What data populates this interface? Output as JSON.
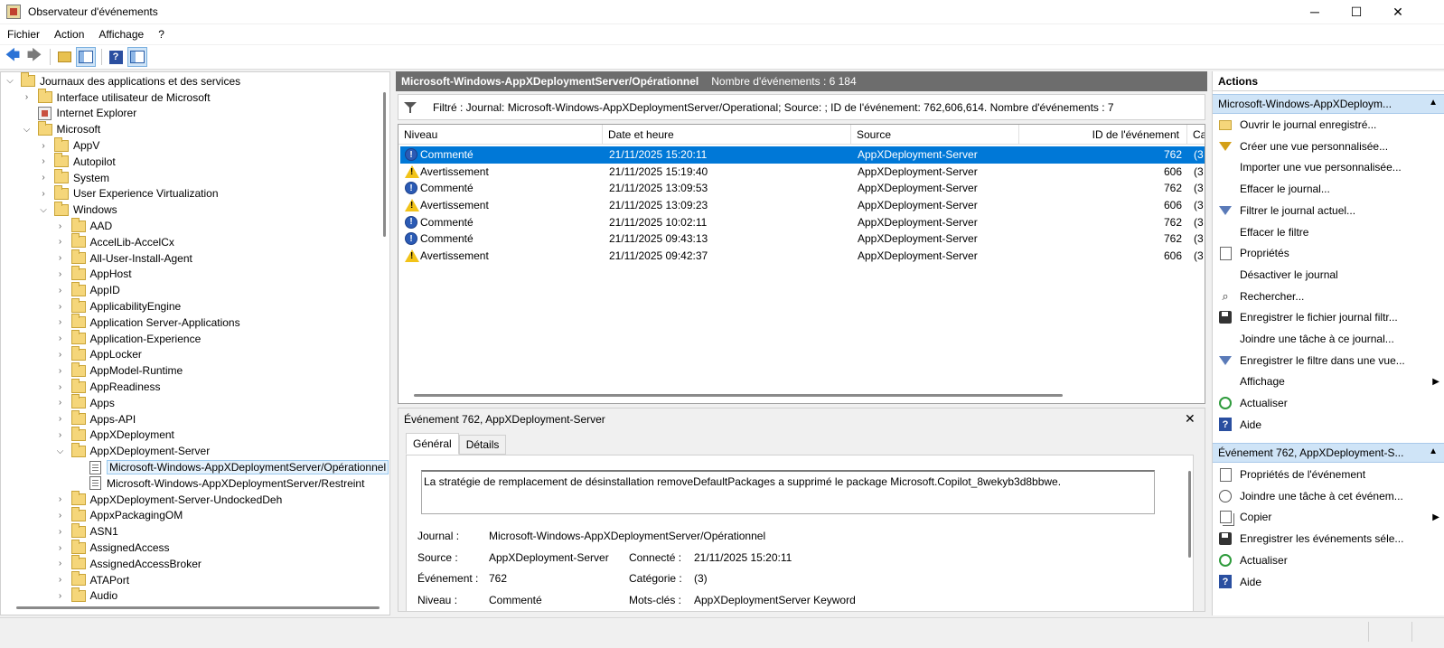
{
  "window": {
    "title": "Observateur d'événements",
    "minimize": "─",
    "maximize": "☐",
    "close": "✕"
  },
  "menu": [
    "Fichier",
    "Action",
    "Affichage",
    "?"
  ],
  "toolbar": {
    "back": "🡄",
    "forward": "🡆",
    "help": "?"
  },
  "tree": [
    {
      "label": "Journaux des applications et des services",
      "level": 0,
      "expander": "open",
      "icon": "folder"
    },
    {
      "label": "Interface utilisateur de Microsoft",
      "level": 1,
      "expander": "closed",
      "icon": "folder"
    },
    {
      "label": "Internet Explorer",
      "level": 1,
      "expander": "none",
      "icon": "ie"
    },
    {
      "label": "Microsoft",
      "level": 1,
      "expander": "open",
      "icon": "folder"
    },
    {
      "label": "AppV",
      "level": 2,
      "expander": "closed",
      "icon": "folder"
    },
    {
      "label": "Autopilot",
      "level": 2,
      "expander": "closed",
      "icon": "folder"
    },
    {
      "label": "System",
      "level": 2,
      "expander": "closed",
      "icon": "folder"
    },
    {
      "label": "User Experience Virtualization",
      "level": 2,
      "expander": "closed",
      "icon": "folder"
    },
    {
      "label": "Windows",
      "level": 2,
      "expander": "open",
      "icon": "folder"
    },
    {
      "label": "AAD",
      "level": 3,
      "expander": "closed",
      "icon": "folder"
    },
    {
      "label": "AccelLib-AccelCx",
      "level": 3,
      "expander": "closed",
      "icon": "folder"
    },
    {
      "label": "All-User-Install-Agent",
      "level": 3,
      "expander": "closed",
      "icon": "folder"
    },
    {
      "label": "AppHost",
      "level": 3,
      "expander": "closed",
      "icon": "folder"
    },
    {
      "label": "AppID",
      "level": 3,
      "expander": "closed",
      "icon": "folder"
    },
    {
      "label": "ApplicabilityEngine",
      "level": 3,
      "expander": "closed",
      "icon": "folder"
    },
    {
      "label": "Application Server-Applications",
      "level": 3,
      "expander": "closed",
      "icon": "folder"
    },
    {
      "label": "Application-Experience",
      "level": 3,
      "expander": "closed",
      "icon": "folder"
    },
    {
      "label": "AppLocker",
      "level": 3,
      "expander": "closed",
      "icon": "folder"
    },
    {
      "label": "AppModel-Runtime",
      "level": 3,
      "expander": "closed",
      "icon": "folder"
    },
    {
      "label": "AppReadiness",
      "level": 3,
      "expander": "closed",
      "icon": "folder"
    },
    {
      "label": "Apps",
      "level": 3,
      "expander": "closed",
      "icon": "folder"
    },
    {
      "label": "Apps-API",
      "level": 3,
      "expander": "closed",
      "icon": "folder"
    },
    {
      "label": "AppXDeployment",
      "level": 3,
      "expander": "closed",
      "icon": "folder"
    },
    {
      "label": "AppXDeployment-Server",
      "level": 3,
      "expander": "open",
      "icon": "folder"
    },
    {
      "label": "Microsoft-Windows-AppXDeploymentServer/Opérationnel",
      "level": 4,
      "expander": "none",
      "icon": "log",
      "selected": true
    },
    {
      "label": "Microsoft-Windows-AppXDeploymentServer/Restreint",
      "level": 4,
      "expander": "none",
      "icon": "log"
    },
    {
      "label": "AppXDeployment-Server-UndockedDeh",
      "level": 3,
      "expander": "closed",
      "icon": "folder"
    },
    {
      "label": "AppxPackagingOM",
      "level": 3,
      "expander": "closed",
      "icon": "folder"
    },
    {
      "label": "ASN1",
      "level": 3,
      "expander": "closed",
      "icon": "folder"
    },
    {
      "label": "AssignedAccess",
      "level": 3,
      "expander": "closed",
      "icon": "folder"
    },
    {
      "label": "AssignedAccessBroker",
      "level": 3,
      "expander": "closed",
      "icon": "folder"
    },
    {
      "label": "ATAPort",
      "level": 3,
      "expander": "closed",
      "icon": "folder"
    },
    {
      "label": "Audio",
      "level": 3,
      "expander": "closed",
      "icon": "folder"
    }
  ],
  "center": {
    "log_name": "Microsoft-Windows-AppXDeploymentServer/Opérationnel",
    "event_count": "Nombre d'événements : 6 184",
    "filter_text": "Filtré : Journal: Microsoft-Windows-AppXDeploymentServer/Operational; Source: ; ID de l'événement: 762,606,614. Nombre d'événements : 7",
    "columns": {
      "level": "Niveau",
      "date": "Date et heure",
      "source": "Source",
      "id": "ID de l'événement",
      "category": "Ca"
    },
    "rows": [
      {
        "level": "Commenté",
        "type": "info",
        "date": "21/11/2025 15:20:11",
        "source": "AppXDeployment-Server",
        "id": "762",
        "category": "(3",
        "selected": true
      },
      {
        "level": "Avertissement",
        "type": "warn",
        "date": "21/11/2025 15:19:40",
        "source": "AppXDeployment-Server",
        "id": "606",
        "category": "(3"
      },
      {
        "level": "Commenté",
        "type": "info",
        "date": "21/11/2025 13:09:53",
        "source": "AppXDeployment-Server",
        "id": "762",
        "category": "(3"
      },
      {
        "level": "Avertissement",
        "type": "warn",
        "date": "21/11/2025 13:09:23",
        "source": "AppXDeployment-Server",
        "id": "606",
        "category": "(3"
      },
      {
        "level": "Commenté",
        "type": "info",
        "date": "21/11/2025 10:02:11",
        "source": "AppXDeployment-Server",
        "id": "762",
        "category": "(3"
      },
      {
        "level": "Commenté",
        "type": "info",
        "date": "21/11/2025 09:43:13",
        "source": "AppXDeployment-Server",
        "id": "762",
        "category": "(3"
      },
      {
        "level": "Avertissement",
        "type": "warn",
        "date": "21/11/2025 09:42:37",
        "source": "AppXDeployment-Server",
        "id": "606",
        "category": "(3"
      }
    ]
  },
  "detail": {
    "title": "Événement 762, AppXDeployment-Server",
    "close": "✕",
    "tabs": [
      "Général",
      "Détails"
    ],
    "description": "La stratégie de remplacement de désinstallation removeDefaultPackages a supprimé le package Microsoft.Copilot_8wekyb3d8bbwe.",
    "journal_label": "Journal :",
    "journal_value": "Microsoft-Windows-AppXDeploymentServer/Opérationnel",
    "source_label": "Source :",
    "source_value": "AppXDeployment-Server",
    "connected_label": "Connecté :",
    "connected_value": "21/11/2025 15:20:11",
    "event_label": "Événement :",
    "event_value": "762",
    "category_label": "Catégorie :",
    "category_value": "(3)",
    "level_label": "Niveau :",
    "level_value": "Commenté",
    "keywords_label": "Mots-clés :",
    "keywords_value": "AppXDeploymentServer Keyword"
  },
  "actions": {
    "title": "Actions",
    "section1": "Microsoft-Windows-AppXDeploym...",
    "items1": [
      {
        "label": "Ouvrir le journal enregistré...",
        "icon": "open"
      },
      {
        "label": "Créer une vue personnalisée...",
        "icon": "funnel"
      },
      {
        "label": "Importer une vue personnalisée...",
        "icon": "none"
      },
      {
        "label": "Effacer le journal...",
        "icon": "none"
      },
      {
        "label": "Filtrer le journal actuel...",
        "icon": "funnel-blue"
      },
      {
        "label": "Effacer le filtre",
        "icon": "none"
      },
      {
        "label": "Propriétés",
        "icon": "prop"
      },
      {
        "label": "Désactiver le journal",
        "icon": "none"
      },
      {
        "label": "Rechercher...",
        "icon": "bino"
      },
      {
        "label": "Enregistrer le fichier journal filtr...",
        "icon": "save"
      },
      {
        "label": "Joindre une tâche à ce journal...",
        "icon": "none"
      },
      {
        "label": "Enregistrer le filtre dans une vue...",
        "icon": "funnel-blue"
      },
      {
        "label": "Affichage",
        "icon": "none",
        "submenu": true
      },
      {
        "label": "Actualiser",
        "icon": "refresh"
      },
      {
        "label": "Aide",
        "icon": "help"
      }
    ],
    "section2": "Événement 762, AppXDeployment-S...",
    "items2": [
      {
        "label": "Propriétés de l'événement",
        "icon": "prop"
      },
      {
        "label": "Joindre une tâche à cet événem...",
        "icon": "clock"
      },
      {
        "label": "Copier",
        "icon": "copy",
        "submenu": true
      },
      {
        "label": "Enregistrer les événements séle...",
        "icon": "save"
      },
      {
        "label": "Actualiser",
        "icon": "refresh"
      },
      {
        "label": "Aide",
        "icon": "help"
      }
    ],
    "up_arrow": "▲",
    "submenu_arrow": "▶"
  }
}
